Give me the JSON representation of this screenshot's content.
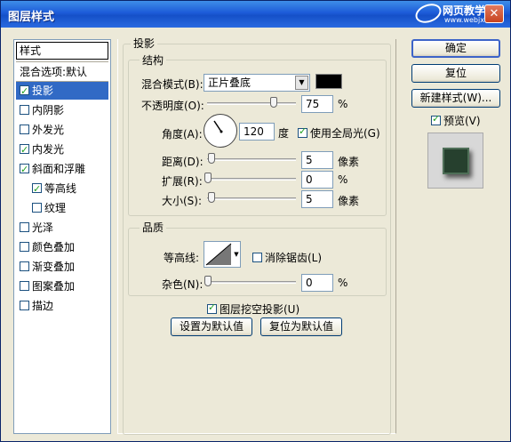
{
  "window": {
    "title": "图层样式",
    "watermark_text": "网页教学网",
    "watermark_url": "www.webjx.com",
    "close_symbol": "✕"
  },
  "left": {
    "header": "样式",
    "blend_options": "混合选项:默认",
    "items": [
      {
        "label": "投影",
        "checked": true,
        "selected": true
      },
      {
        "label": "内阴影",
        "checked": false
      },
      {
        "label": "外发光",
        "checked": false
      },
      {
        "label": "内发光",
        "checked": true
      },
      {
        "label": "斜面和浮雕",
        "checked": true
      },
      {
        "label": "等高线",
        "checked": true
      },
      {
        "label": "纹理",
        "checked": false
      },
      {
        "label": "光泽",
        "checked": false
      },
      {
        "label": "颜色叠加",
        "checked": false
      },
      {
        "label": "渐变叠加",
        "checked": false
      },
      {
        "label": "图案叠加",
        "checked": false
      },
      {
        "label": "描边",
        "checked": false
      }
    ]
  },
  "shadow": {
    "title": "投影",
    "structure_title": "结构",
    "blend_mode_label": "混合模式(B):",
    "blend_mode_value": "正片叠底",
    "color": "#000000",
    "opacity_label": "不透明度(O):",
    "opacity_value": "75",
    "opacity_unit": "%",
    "opacity_level": 0.75,
    "angle_label": "角度(A):",
    "angle_value": "120",
    "angle_unit": "度",
    "global_light_label": "使用全局光(G)",
    "global_light_checked": true,
    "distance_label": "距离(D):",
    "distance_value": "5",
    "distance_unit": "像素",
    "spread_label": "扩展(R):",
    "spread_value": "0",
    "spread_unit": "%",
    "size_label": "大小(S):",
    "size_value": "5",
    "size_unit": "像素",
    "quality_title": "品质",
    "contour_label": "等高线:",
    "antialias_label": "消除锯齿(L)",
    "antialias_checked": false,
    "noise_label": "杂色(N):",
    "noise_value": "0",
    "noise_unit": "%",
    "knockout_label": "图层挖空投影(U)",
    "knockout_checked": true,
    "set_default_label": "设置为默认值",
    "reset_default_label": "复位为默认值"
  },
  "right": {
    "ok_label": "确定",
    "reset_label": "复位",
    "new_style_label": "新建样式(W)...",
    "preview_label": "预览(V)",
    "preview_checked": true
  }
}
